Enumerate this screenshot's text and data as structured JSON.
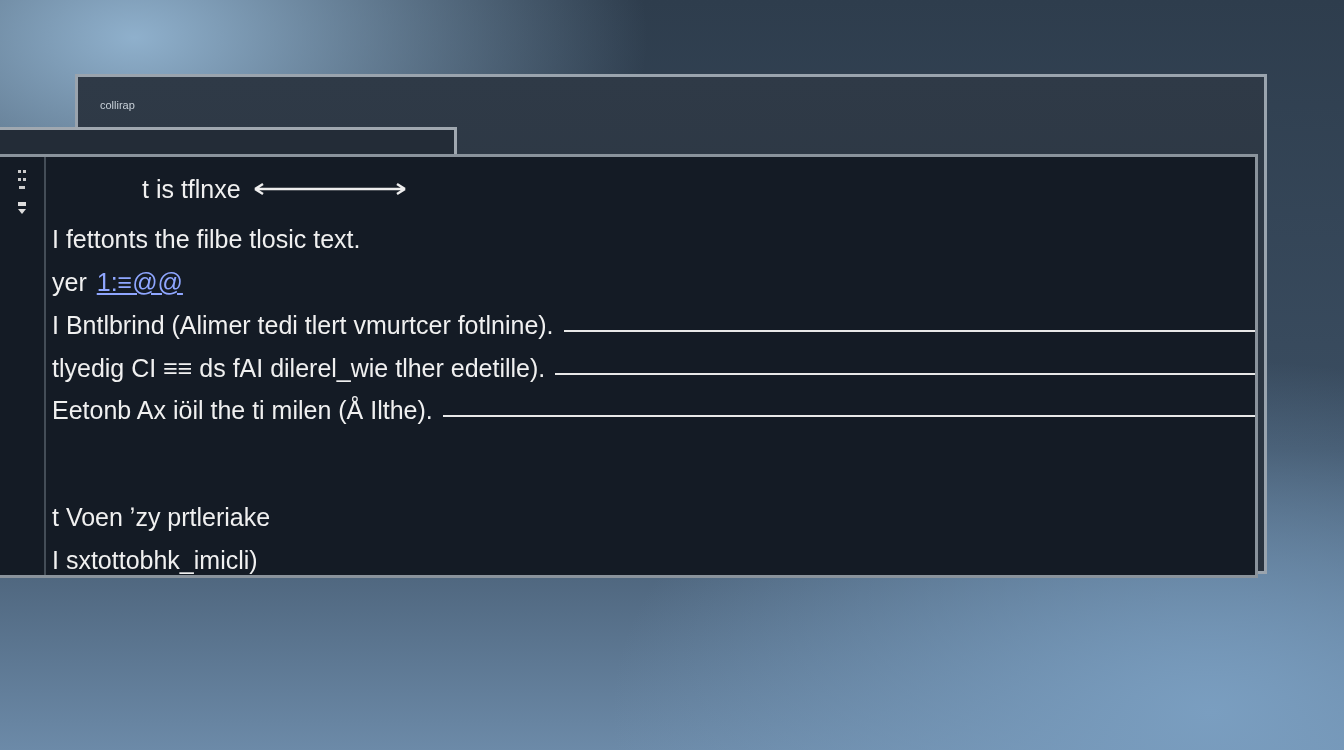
{
  "back_window": {
    "title": "collirap"
  },
  "editor": {
    "heading": "t is tflnxe",
    "lines": [
      {
        "text": "I fettonts the filbe tlosic text.",
        "fill_line": false
      },
      {
        "text": "yer",
        "link": "1:≡@@",
        "fill_line": false
      },
      {
        "text": "I Bntlbrind (Alimer tedi tlert vmurtcer fotlnine).",
        "fill_line": true
      },
      {
        "text": "tlyedig CI ≡≡ ds fAI dilerel_wie tlher edetille).",
        "fill_line": true
      },
      {
        "text": "Eetonb Ax iöil the ti milen (Å Ilthe).",
        "fill_line": true
      }
    ],
    "footer_lines": [
      "t Voen ʼzy prtleriake",
      "I sxtottobhk_imicli)"
    ]
  }
}
